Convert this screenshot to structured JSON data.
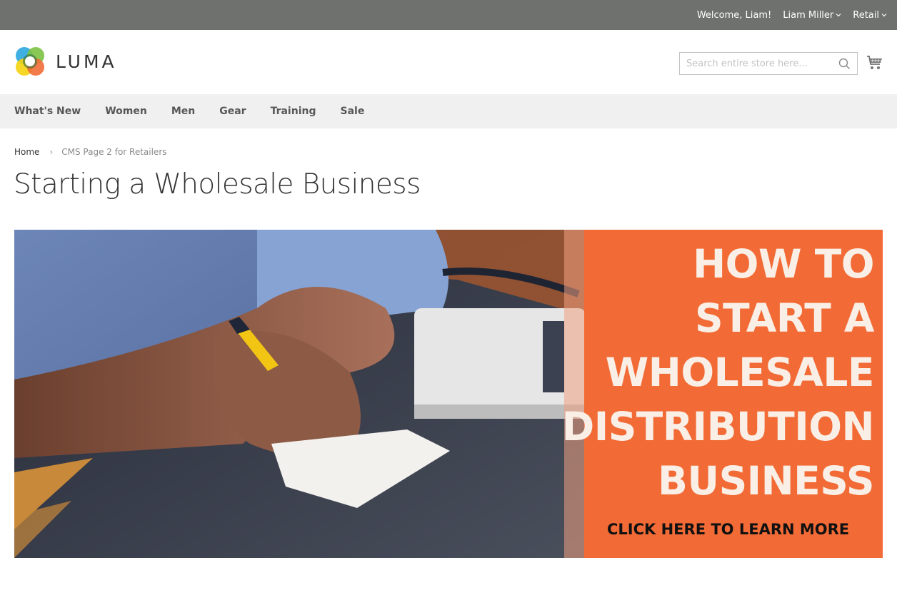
{
  "topbar": {
    "welcome": "Welcome, Liam!",
    "account_label": "Liam Miller",
    "store_label": "Retail"
  },
  "header": {
    "logo_text": "LUMA",
    "search": {
      "placeholder": "Search entire store here...",
      "value": ""
    },
    "icons": {
      "search": "search-icon",
      "cart": "cart-icon"
    }
  },
  "nav": {
    "items": [
      {
        "label": "What's New"
      },
      {
        "label": "Women"
      },
      {
        "label": "Men"
      },
      {
        "label": "Gear"
      },
      {
        "label": "Training"
      },
      {
        "label": "Sale"
      }
    ]
  },
  "breadcrumb": {
    "home": "Home",
    "separator": "›",
    "current": "CMS Page 2 for Retailers"
  },
  "page": {
    "title": "Starting a Wholesale Business"
  },
  "banner": {
    "headline_lines": [
      "HOW TO",
      "START A",
      "WHOLESALE",
      "DISTRIBUTION",
      "BUSINESS"
    ],
    "cta": "CLICK HERE TO LEARN MORE",
    "accent_color": "#f26b36",
    "image_description": "man in blue shirt writing on paper next to laptop"
  }
}
